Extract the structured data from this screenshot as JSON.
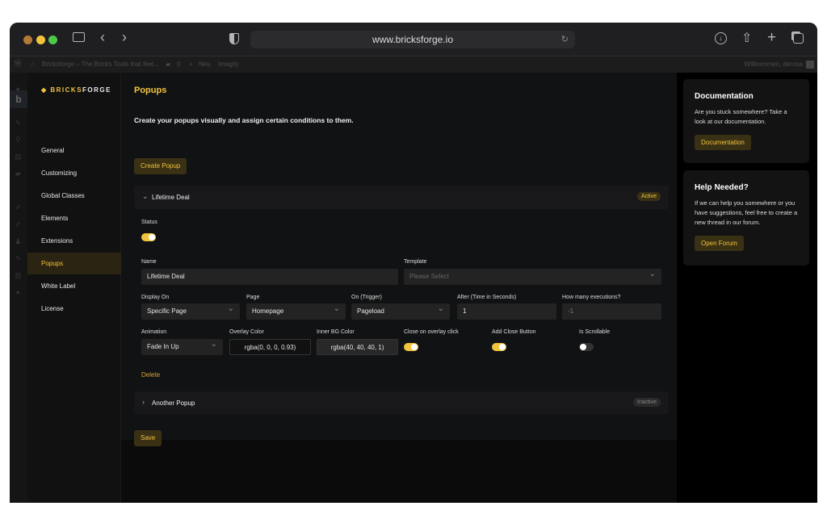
{
  "browser": {
    "url": "www.bricksforge.io",
    "colors": {
      "close": "#b07a35",
      "min": "#f2c43d",
      "max": "#4cc94a"
    }
  },
  "adminbar": {
    "site": "Bricksforge – The Bricks Tools that feel...",
    "comments": "0",
    "new": "Neu",
    "imagify": "Imagify",
    "greeting": "Willkommen, derosa"
  },
  "brand": {
    "name_a": "BRICKS",
    "name_b": "FORGE"
  },
  "sidebar": {
    "items": [
      {
        "label": "General"
      },
      {
        "label": "Customizing"
      },
      {
        "label": "Global Classes"
      },
      {
        "label": "Elements"
      },
      {
        "label": "Extensions"
      },
      {
        "label": "Popups",
        "active": true
      },
      {
        "label": "White Label"
      },
      {
        "label": "License"
      }
    ]
  },
  "main": {
    "title": "Popups",
    "subtitle": "Create your popups visually and assign certain conditions to them.",
    "create_button": "Create Popup",
    "popups": [
      {
        "name": "Lifetime Deal",
        "status_badge": "Active",
        "expanded": true
      },
      {
        "name": "Another Popup",
        "status_badge": "Inactive",
        "expanded": false
      }
    ],
    "form": {
      "status_label": "Status",
      "status_on": true,
      "name_label": "Name",
      "name_value": "Lifetime Deal",
      "template_label": "Template",
      "template_placeholder": "Please Select",
      "display_on_label": "Display On",
      "display_on_value": "Specific Page",
      "page_label": "Page",
      "page_value": "Homepage",
      "trigger_label": "On (Trigger)",
      "trigger_value": "Pageload",
      "after_label": "After (Time in Seconds)",
      "after_value": "1",
      "executions_label": "How many executions?",
      "executions_value": "-1",
      "animation_label": "Animation",
      "animation_value": "Fade In Up",
      "overlay_label": "Overlay Color",
      "overlay_value": "rgba(0, 0, 0, 0.93)",
      "inner_bg_label": "Inner BG Color",
      "inner_bg_value": "rgba(40, 40, 40, 1)",
      "close_overlay_label": "Close on overlay click",
      "close_overlay_on": true,
      "close_button_label": "Add Close Button",
      "close_button_on": true,
      "scrollable_label": "Is Scrollable",
      "scrollable_on": false,
      "delete_label": "Delete"
    },
    "save_button": "Save"
  },
  "right": {
    "doc": {
      "title": "Documentation",
      "text": "Are you stuck somewhere? Take a look at our documentation.",
      "button": "Documentation"
    },
    "help": {
      "title": "Help Needed?",
      "text": "If we can help you somewhere or you have suggestions, feel free to create a new thread in our forum.",
      "button": "Open Forum"
    }
  },
  "accent": "#f2c43d"
}
